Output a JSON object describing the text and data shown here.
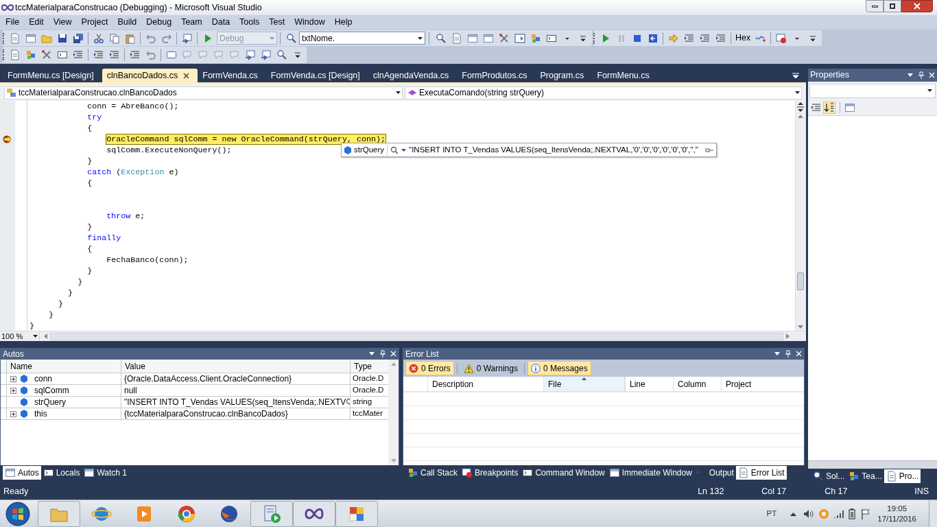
{
  "window": {
    "title": "tccMaterialparaConstrucao (Debugging) - Microsoft Visual Studio"
  },
  "menu": [
    "File",
    "Edit",
    "View",
    "Project",
    "Build",
    "Debug",
    "Team",
    "Data",
    "Tools",
    "Test",
    "Window",
    "Help"
  ],
  "toolbar": {
    "configuration": "Debug",
    "find": "txtNome.",
    "hex": "Hex"
  },
  "document_tabs": [
    {
      "label": "FormMenu.cs [Design]",
      "selected": false
    },
    {
      "label": "clnBancoDados.cs",
      "selected": true
    },
    {
      "label": "FormVenda.cs",
      "selected": false
    },
    {
      "label": "FormVenda.cs [Design]",
      "selected": false
    },
    {
      "label": "clnAgendaVenda.cs",
      "selected": false
    },
    {
      "label": "FormProdutos.cs",
      "selected": false
    },
    {
      "label": "Program.cs",
      "selected": false
    },
    {
      "label": "FormMenu.cs",
      "selected": false
    }
  ],
  "navigation": {
    "type": "tccMaterialparaConstrucao.clnBancoDados",
    "member": "ExecutaComando(string strQuery)"
  },
  "code": [
    {
      "tokens": [
        {
          "text": "            conn = AbreBanco();",
          "kind": "plain"
        }
      ]
    },
    {
      "tokens": [
        {
          "text": "            try",
          "kind": "keyword"
        }
      ]
    },
    {
      "tokens": [
        {
          "text": "            {",
          "kind": "plain"
        }
      ]
    },
    {
      "current": true,
      "tokens": [
        {
          "text": "                OracleCommand sqlComm = new OracleCommand(strQuery, conn);",
          "kind": "plain"
        }
      ]
    },
    {
      "tokens": [
        {
          "text": "                sqlComm.ExecuteNonQuery();",
          "kind": "plain"
        }
      ]
    },
    {
      "tokens": [
        {
          "text": "            }",
          "kind": "plain"
        }
      ]
    },
    {
      "tokens": [
        {
          "text": "            catch",
          "kind": "keyword"
        },
        {
          "text": " (",
          "kind": "plain"
        },
        {
          "text": "Exception",
          "kind": "type"
        },
        {
          "text": " e)",
          "kind": "plain"
        }
      ]
    },
    {
      "tokens": [
        {
          "text": "            {",
          "kind": "plain"
        }
      ]
    },
    {
      "kind": "blank"
    },
    {
      "kind": "blank"
    },
    {
      "tokens": [
        {
          "text": "                throw",
          "kind": "keyword"
        },
        {
          "text": " e;",
          "kind": "plain"
        }
      ]
    },
    {
      "tokens": [
        {
          "text": "            }",
          "kind": "plain"
        }
      ]
    },
    {
      "tokens": [
        {
          "text": "            finally",
          "kind": "keyword"
        }
      ]
    },
    {
      "tokens": [
        {
          "text": "            {",
          "kind": "plain"
        }
      ]
    },
    {
      "tokens": [
        {
          "text": "                FechaBanco(conn);",
          "kind": "plain"
        }
      ]
    },
    {
      "tokens": [
        {
          "text": "            }",
          "kind": "plain"
        }
      ]
    },
    {
      "tokens": [
        {
          "text": "          }",
          "kind": "plain"
        }
      ]
    },
    {
      "tokens": [
        {
          "text": "        }",
          "kind": "plain"
        }
      ]
    },
    {
      "tokens": [
        {
          "text": "      }",
          "kind": "plain"
        }
      ]
    },
    {
      "tokens": [
        {
          "text": "    }",
          "kind": "plain"
        }
      ]
    },
    {
      "tokens": [
        {
          "text": "}",
          "kind": "plain"
        }
      ]
    }
  ],
  "datatip": {
    "name": "strQuery",
    "value": "\"INSERT INTO T_Vendas VALUES(seq_ItensVenda;.NEXTVAL,'0','0','0','0','0','0','',\""
  },
  "zoom": "100 %",
  "properties": {
    "title": "Properties"
  },
  "autos": {
    "title": "Autos",
    "columns": [
      "Name",
      "Value",
      "Type"
    ],
    "rows": [
      {
        "name": "conn",
        "value": "{Oracle.DataAccess.Client.OracleConnection}",
        "type": "Oracle.D",
        "expandable": true
      },
      {
        "name": "sqlComm",
        "value": "null",
        "type": "Oracle.D",
        "expandable": true
      },
      {
        "name": "strQuery",
        "value": "\"INSERT INTO T_Vendas VALUES(seq_ItensVenda;.NEXTV",
        "type": "string",
        "expandable": false
      },
      {
        "name": "this",
        "value": "{tccMaterialparaConstrucao.clnBancoDados}",
        "type": "tccMater",
        "expandable": true
      }
    ]
  },
  "autos_tabs": [
    {
      "label": "Autos",
      "selected": true
    },
    {
      "label": "Locals",
      "selected": false
    },
    {
      "label": "Watch 1",
      "selected": false
    }
  ],
  "error_list": {
    "title": "Error List",
    "filters": [
      {
        "label": "0 Errors",
        "kind": "error",
        "selected": true
      },
      {
        "label": "0 Warnings",
        "kind": "warning",
        "selected": false
      },
      {
        "label": "0 Messages",
        "kind": "info",
        "selected": true
      }
    ],
    "columns": [
      "Description",
      "File",
      "Line",
      "Column",
      "Project"
    ]
  },
  "error_tabs": [
    {
      "label": "Call Stack",
      "selected": false
    },
    {
      "label": "Breakpoints",
      "selected": false
    },
    {
      "label": "Command Window",
      "selected": false
    },
    {
      "label": "Immediate Window",
      "selected": false
    },
    {
      "label": "Output",
      "selected": false
    },
    {
      "label": "Error List",
      "selected": true
    }
  ],
  "side_tabs": [
    {
      "label": "Sol...",
      "selected": false
    },
    {
      "label": "Tea...",
      "selected": false
    },
    {
      "label": "Pro...",
      "selected": true
    }
  ],
  "status_bar": {
    "text": "Ready",
    "line": "Ln 132",
    "column": "Col 17",
    "char": "Ch 17",
    "mode": "INS"
  },
  "taskbar": {
    "language": "PT",
    "time": "19:05",
    "date": "17/11/2016"
  }
}
